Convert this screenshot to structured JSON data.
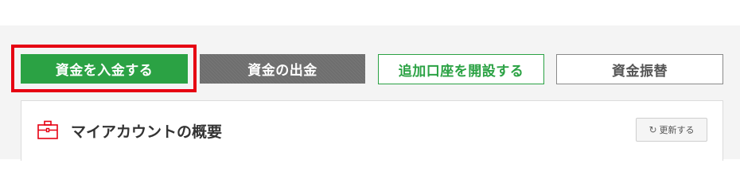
{
  "actions": {
    "deposit_label": "資金を入金する",
    "withdraw_label": "資金の出金",
    "add_account_label": "追加口座を開設する",
    "transfer_label": "資金振替"
  },
  "account_summary": {
    "title": "マイアカウントの概要",
    "refresh_label": "更新する",
    "icon": "briefcase-icon",
    "refresh_icon": "refresh-icon"
  },
  "colors": {
    "primary_green": "#2ba244",
    "highlight_red": "#e60012",
    "withdraw_gray": "#6e6e6e"
  }
}
